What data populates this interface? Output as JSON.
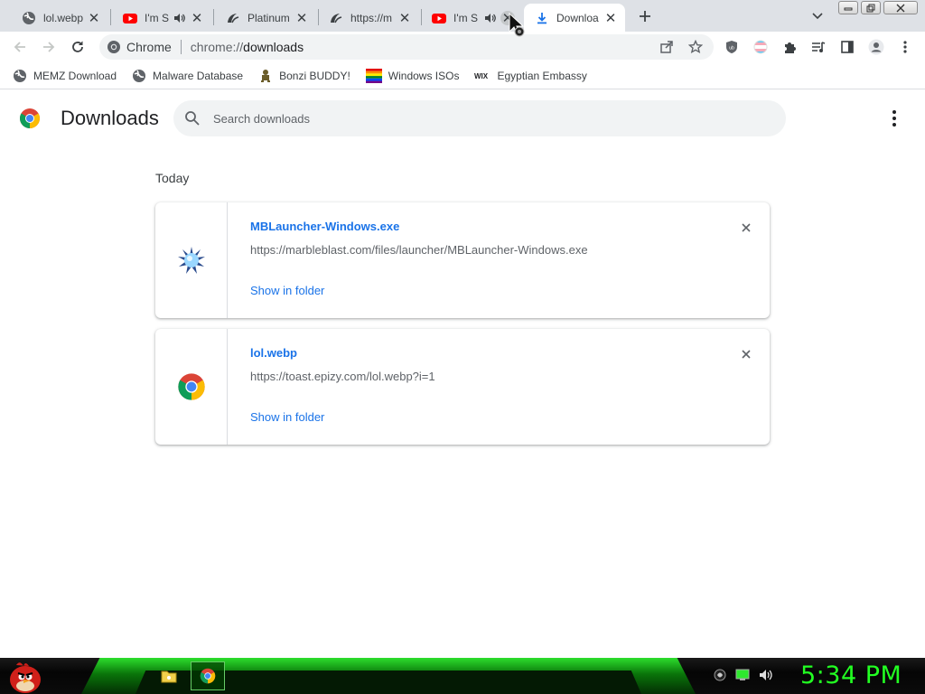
{
  "tabs": [
    {
      "title": "lol.webp",
      "favicon": "globe-icon",
      "audio": false,
      "active": false
    },
    {
      "title": "I'm S",
      "favicon": "youtube-icon",
      "audio": true,
      "active": false
    },
    {
      "title": "Platinum",
      "favicon": "marble-blast-icon",
      "audio": false,
      "active": false
    },
    {
      "title": "https://m",
      "favicon": "marble-blast-icon",
      "audio": false,
      "active": false
    },
    {
      "title": "I'm S",
      "favicon": "youtube-icon",
      "audio": true,
      "active": false
    },
    {
      "title": "Downloa",
      "favicon": "download-icon",
      "audio": false,
      "active": true
    }
  ],
  "omnibox": {
    "chip_label": "Chrome",
    "url_scheme": "chrome://",
    "url_host": "downloads"
  },
  "bookmarks": [
    {
      "label": "MEMZ Download",
      "icon": "globe-icon"
    },
    {
      "label": "Malware Database",
      "icon": "globe-icon"
    },
    {
      "label": "Bonzi BUDDY!",
      "icon": "bonzi-icon"
    },
    {
      "label": "Windows ISOs",
      "icon": "rainbow-flag-icon"
    },
    {
      "label": "Egyptian Embassy",
      "icon": "wix-icon"
    }
  ],
  "page": {
    "title": "Downloads",
    "search_placeholder": "Search downloads",
    "section_date": "Today"
  },
  "downloads": [
    {
      "file_name": "MBLauncher-Windows.exe",
      "url": "https://marbleblast.com/files/launcher/MBLauncher-Windows.exe",
      "action": "Show in folder",
      "icon": "marble-blast-launcher-icon"
    },
    {
      "file_name": "lol.webp",
      "url": "https://toast.epizy.com/lol.webp?i=1",
      "action": "Show in folder",
      "icon": "chrome-icon"
    }
  ],
  "taskbar": {
    "clock": "5:34 PM"
  },
  "colors": {
    "accent": "#1a73e8",
    "tabstrip": "#dee1e6",
    "clock": "#22ff22",
    "taskbar_green": "#2ee82e"
  }
}
